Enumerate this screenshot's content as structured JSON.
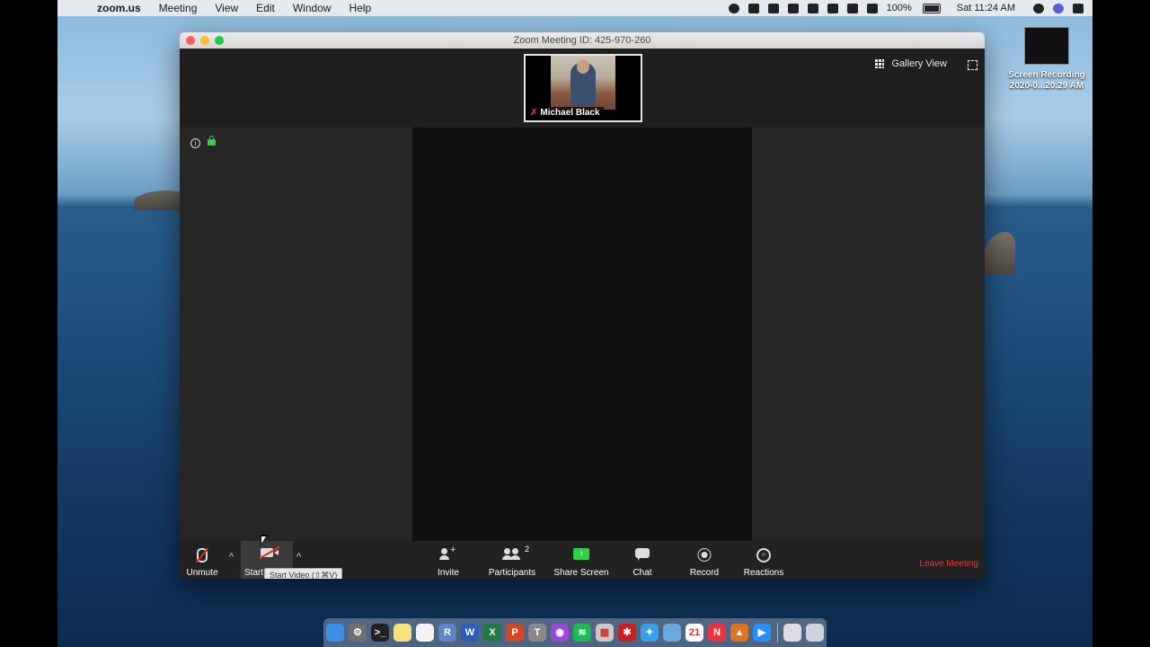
{
  "menubar": {
    "apple_glyph": "",
    "app_name": "zoom.us",
    "items": [
      "Meeting",
      "View",
      "Edit",
      "Window",
      "Help"
    ],
    "battery_text": "100%",
    "clock": "Sat 11:24 AM"
  },
  "desktop": {
    "icon_label_line1": "Screen Recording",
    "icon_label_line2": "2020-0...20.29 AM"
  },
  "window": {
    "title": "Zoom Meeting ID: 425-970-260",
    "gallery_view_label": "Gallery View",
    "participant_thumb_name": "Michael Black",
    "info_glyph": "i"
  },
  "toolbar": {
    "unmute_label": "Unmute",
    "start_video_label": "Start Video",
    "start_video_tooltip": "Start Video (⇧⌘V)",
    "invite_label": "Invite",
    "participants_label": "Participants",
    "participants_count": "2",
    "share_screen_label": "Share Screen",
    "share_glyph": "↑",
    "chat_label": "Chat",
    "record_label": "Record",
    "reactions_label": "Reactions",
    "leave_label": "Leave Meeting",
    "caret_glyph": "^"
  },
  "colors": {
    "leave_red": "#ee3333",
    "share_green": "#2fd14a",
    "muted_red": "#e02828"
  },
  "dock": {
    "icons": [
      {
        "name": "finder",
        "glyph": "",
        "color": "#3b8fe6"
      },
      {
        "name": "system-preferences",
        "glyph": "⚙",
        "color": "#6f6f6f"
      },
      {
        "name": "terminal",
        "glyph": ">_",
        "color": "#222222"
      },
      {
        "name": "notes",
        "glyph": "",
        "color": "#f5e27a"
      },
      {
        "name": "textedit",
        "glyph": "",
        "color": "#f2f2f2"
      },
      {
        "name": "r",
        "glyph": "R",
        "color": "#5c86c4"
      },
      {
        "name": "word",
        "glyph": "W",
        "color": "#2b5eb8"
      },
      {
        "name": "excel",
        "glyph": "X",
        "color": "#1f7a45"
      },
      {
        "name": "powerpoint",
        "glyph": "P",
        "color": "#d24726"
      },
      {
        "name": "tex",
        "glyph": "T",
        "color": "#8a8a8a"
      },
      {
        "name": "podcasts",
        "glyph": "◉",
        "color": "#9a4ad6"
      },
      {
        "name": "spotify",
        "glyph": "≋",
        "color": "#1db954"
      },
      {
        "name": "grid-app",
        "glyph": "▦",
        "color": "#c9c9c9"
      },
      {
        "name": "settings-red",
        "glyph": "✱",
        "color": "#c82020"
      },
      {
        "name": "safari",
        "glyph": "✦",
        "color": "#3ba0e8"
      },
      {
        "name": "preview",
        "glyph": "",
        "color": "#6aa9de"
      },
      {
        "name": "calendar",
        "glyph": "21",
        "color": "#ffffff"
      },
      {
        "name": "news",
        "glyph": "N",
        "color": "#f0303f"
      },
      {
        "name": "matlab",
        "glyph": "▲",
        "color": "#e0731f"
      },
      {
        "name": "zoom",
        "glyph": "▶",
        "color": "#2d8cff"
      },
      {
        "name": "documents",
        "glyph": "",
        "color": "#dddddd"
      },
      {
        "name": "trash",
        "glyph": "",
        "color": "#cfd4da"
      }
    ]
  }
}
